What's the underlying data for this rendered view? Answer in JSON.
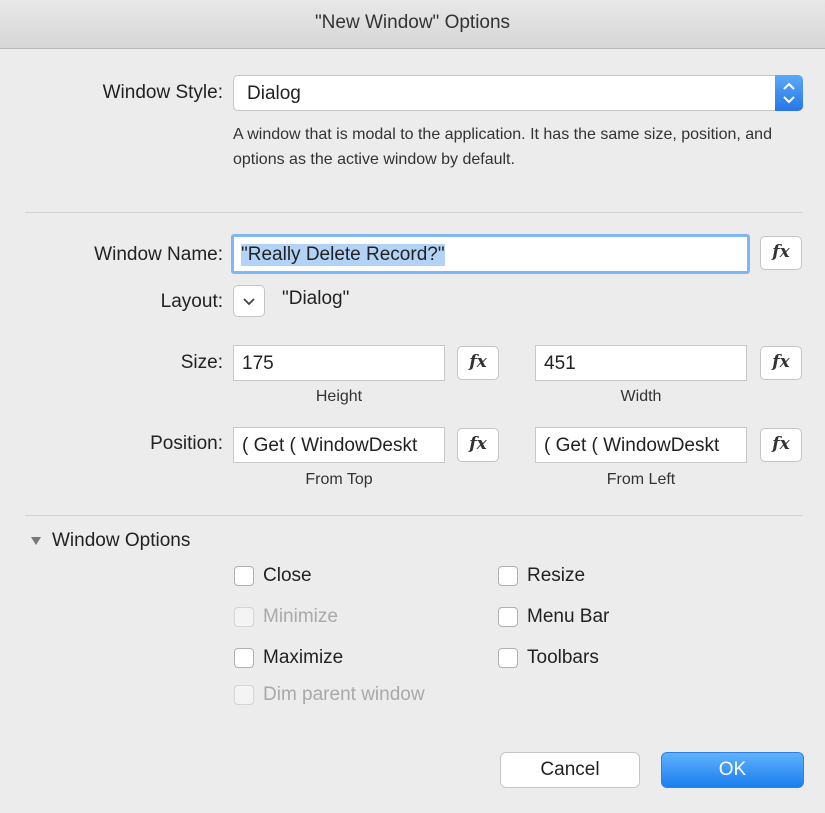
{
  "window": {
    "title": "\"New Window\" Options"
  },
  "window_style": {
    "label": "Window Style:",
    "value": "Dialog",
    "description": "A window that is modal to the application. It has the same size, position, and options as the active window by default."
  },
  "window_name": {
    "label": "Window Name:",
    "value": "\"Really Delete Record?\"",
    "fx": "fx"
  },
  "layout": {
    "label": "Layout:",
    "value": "\"Dialog\""
  },
  "size": {
    "label": "Size:",
    "height": {
      "value": "175",
      "caption": "Height",
      "fx": "fx"
    },
    "width": {
      "value": "451",
      "caption": "Width",
      "fx": "fx"
    }
  },
  "position": {
    "label": "Position:",
    "top": {
      "value": "( Get ( WindowDeskt",
      "caption": "From Top",
      "fx": "fx"
    },
    "left": {
      "value": "( Get ( WindowDeskt",
      "caption": "From Left",
      "fx": "fx"
    }
  },
  "window_options": {
    "title": "Window Options",
    "checkboxes": {
      "close": {
        "label": "Close",
        "checked": false,
        "enabled": true
      },
      "minimize": {
        "label": "Minimize",
        "checked": false,
        "enabled": false
      },
      "maximize": {
        "label": "Maximize",
        "checked": false,
        "enabled": true
      },
      "dim_parent": {
        "label": "Dim parent window",
        "checked": false,
        "enabled": false
      },
      "resize": {
        "label": "Resize",
        "checked": false,
        "enabled": true
      },
      "menu_bar": {
        "label": "Menu Bar",
        "checked": false,
        "enabled": true
      },
      "toolbars": {
        "label": "Toolbars",
        "checked": false,
        "enabled": true
      }
    }
  },
  "buttons": {
    "cancel": "Cancel",
    "ok": "OK"
  }
}
